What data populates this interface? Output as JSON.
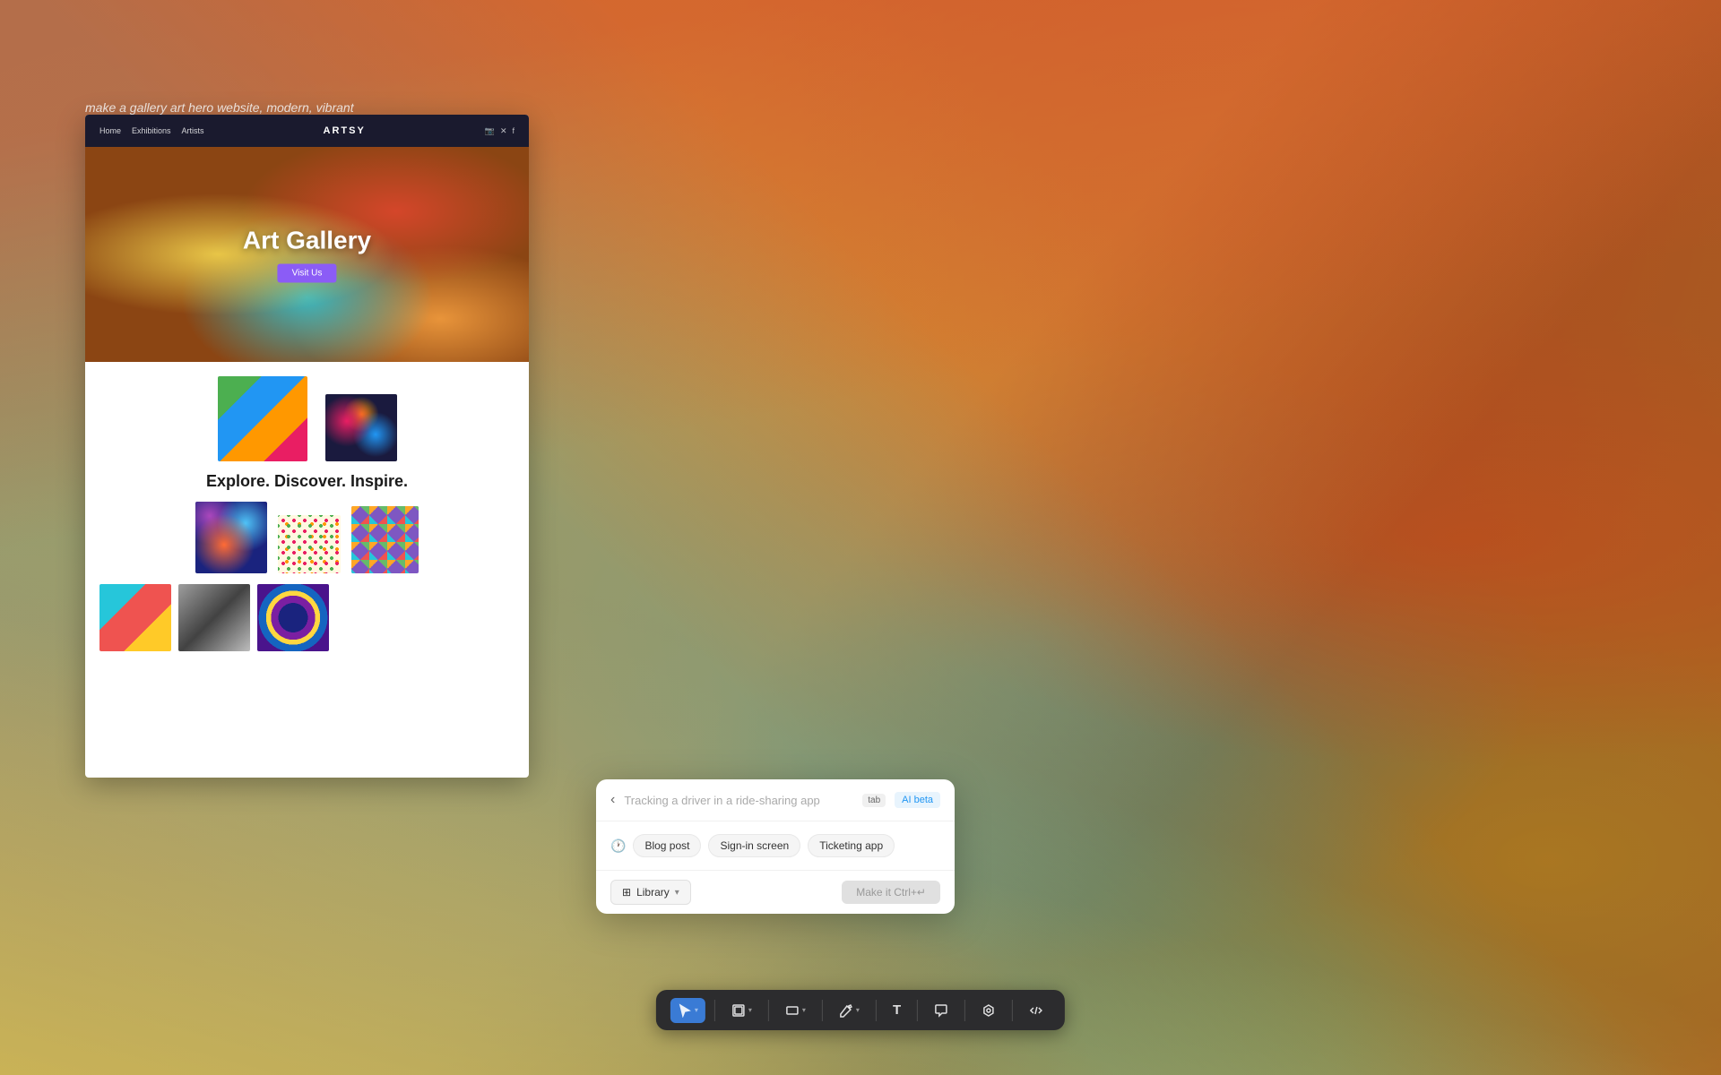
{
  "background": {
    "description": "colorful oil painting texture background"
  },
  "prompt": {
    "text": "make a gallery art hero website, modern, vibrant"
  },
  "website": {
    "logo": "ARTSY",
    "nav": {
      "items": [
        "Home",
        "Exhibitions",
        "Artists"
      ]
    },
    "hero": {
      "title": "Art Gallery",
      "button": "Visit Us"
    },
    "tagline": "Explore. Discover. Inspire."
  },
  "ai_popup": {
    "input_placeholder": "Tracking a driver in a ride-sharing app",
    "tab_label": "tab",
    "beta_label": "AI beta",
    "back_button": "‹",
    "suggestions": {
      "clock_icon": "🕐",
      "chips": [
        "Blog post",
        "Sign-in screen",
        "Ticketing app"
      ]
    },
    "footer": {
      "library_label": "Library",
      "library_icon": "⊞",
      "chevron": "▾",
      "make_it_label": "Make it Ctrl+↵"
    }
  },
  "toolbar": {
    "tools": [
      {
        "name": "select",
        "icon": "cursor",
        "has_dropdown": true,
        "active": true
      },
      {
        "name": "frame",
        "icon": "frame",
        "has_dropdown": true
      },
      {
        "name": "shape",
        "icon": "rectangle",
        "has_dropdown": true
      },
      {
        "name": "pen",
        "icon": "pen",
        "has_dropdown": true
      },
      {
        "name": "text",
        "icon": "T",
        "has_dropdown": false
      },
      {
        "name": "comment",
        "icon": "bubble",
        "has_dropdown": false
      },
      {
        "name": "plugin",
        "icon": "plugin",
        "has_dropdown": false
      },
      {
        "name": "code",
        "icon": "code",
        "has_dropdown": false
      }
    ]
  }
}
